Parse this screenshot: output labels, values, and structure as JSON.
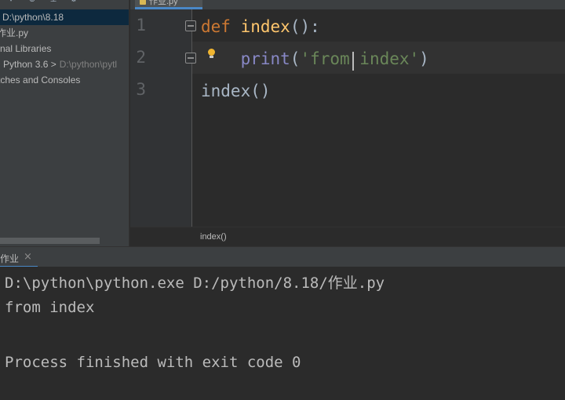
{
  "sidebar": {
    "toolbar_icons": [
      "add-icon",
      "collapse-icon",
      "scroll-from-source-icon",
      "settings-icon"
    ],
    "items": [
      {
        "label": "D:\\python\\8.18",
        "muted": ""
      },
      {
        "label": "作业.py",
        "muted": ""
      },
      {
        "label": "rnal Libraries",
        "muted": ""
      },
      {
        "label": "Python 3.6 >",
        "muted": "D:\\python\\pytl"
      },
      {
        "label": "tches and Consoles",
        "muted": ""
      }
    ]
  },
  "editor": {
    "tab_label": "作业.py",
    "line_numbers": [
      "1",
      "2",
      "3"
    ],
    "code": {
      "line1": {
        "kw": "def",
        "fn": "index",
        "rest": "():"
      },
      "line2": {
        "indent": "    ",
        "builtin": "print",
        "open": "(",
        "str": "'from index'",
        "close": ")"
      },
      "line3": {
        "text": "index()"
      }
    },
    "breadcrumb": "index()"
  },
  "run": {
    "tab_label": "作业",
    "close_glyph": "×",
    "output": [
      "D:\\python\\python.exe D:/python/8.18/作业.py",
      "from index",
      "",
      "Process finished with exit code 0"
    ]
  },
  "colors": {
    "keyword": "#cc7832",
    "function": "#ffc66d",
    "builtin": "#8888c6",
    "string": "#6a8759",
    "selection": "#0d293e",
    "accent": "#4a88c7"
  }
}
